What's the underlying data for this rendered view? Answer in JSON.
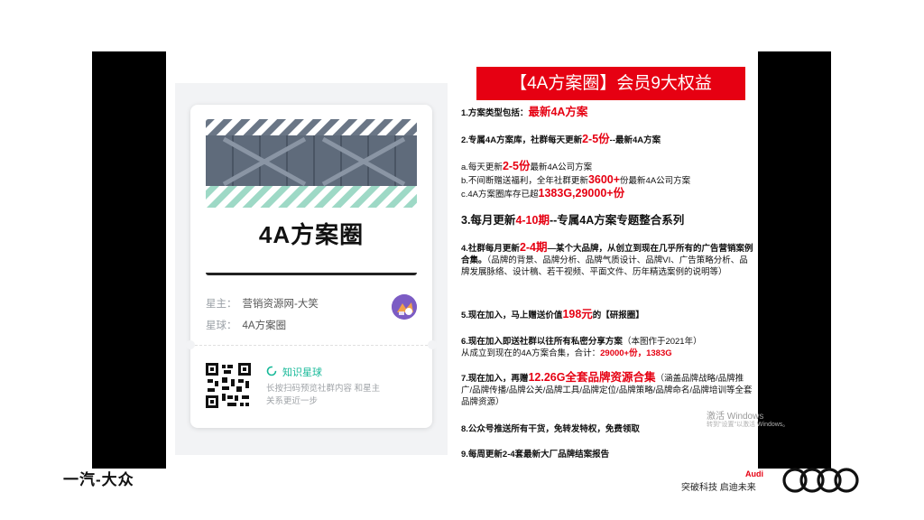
{
  "card": {
    "cover_title": "4A方案圈",
    "owner_label": "星主：",
    "owner_value": "营销资源网-大笑",
    "planet_label": "星球：",
    "planet_value": "4A方案圈",
    "brand_label": "知识星球",
    "scan_hint": "长按扫码预览社群内容 和星主关系更近一步"
  },
  "banner": {
    "title": "【4A方案圈】会员9大权益"
  },
  "rules": {
    "r1_a": "1.方案类型包括：",
    "r1_b": "最新4A方案",
    "r2_a": "2.专属4A方案库，社群每天更新",
    "r2_b": "2-5份",
    "r2_c": "--最新4A方案",
    "ra_a": "a.每天更新",
    "ra_b": "2-5份",
    "ra_c": "最新4A公司方案",
    "rb_a": "b.不间断赠送福利，全年社群更新",
    "rb_b": "3600+",
    "rb_c": "份最新4A公司方案",
    "rc_a": "c.4A方案圈库存已超",
    "rc_b": "1383G,29000+份",
    "r3_a": "3.每月更新",
    "r3_b": "4-10期",
    "r3_c": "--专属4A方案专题整合系列",
    "r4_a": "4.社群每月更新",
    "r4_b": "2-4期",
    "r4_c": "—某个大品牌，从创立到现在几乎所有的广告营销案例合集。",
    "r4_d": "（品牌的背景、品牌分析、品牌气质设计、品牌VI、广告策略分析、品牌发展脉络、设计稿、若干视频、平面文件、历年精选案例的说明等）",
    "r5_a": "5.现在加入，马上赠送价值",
    "r5_b": "198元",
    "r5_c": "的【研报圈】",
    "r6_a": "6.现在加入即送社群以往所有私密分享方案",
    "r6_b": "（本图作于2021年）",
    "r6_c": "从成立到现在的4A方案合集，合计：",
    "r6_d": "29000+份，1383G",
    "r7_a": "7.现在加入，再赠",
    "r7_b": "12.26G全套品牌资源合集",
    "r7_c": "（涵盖品牌战略/品牌推广/品牌传播/品牌公关/品牌工具/品牌定位/品牌策略/品牌命名/品牌培训等全套品牌资源）",
    "r8": "8.公众号推送所有干货，免转发特权，免费领取",
    "r9": "9.每周更新2-4套最新大厂品牌结案报告"
  },
  "watermark": {
    "line1": "激活 Windows",
    "line2": "转到\"设置\"以激活 Windows。"
  },
  "footer": {
    "left_logo": "一汽-大众",
    "audi": "Audi",
    "slogan": "突破科技 启迪未来"
  },
  "colors": {
    "accent_red": "#e60012",
    "brand_green": "#16b998"
  }
}
